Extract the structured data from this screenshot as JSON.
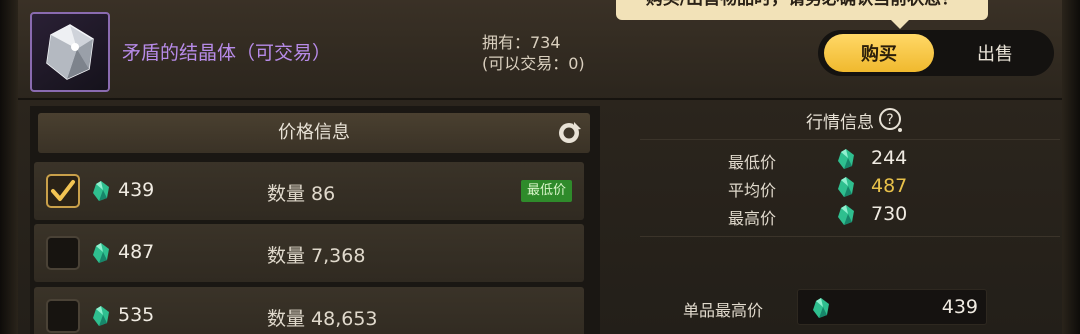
{
  "header": {
    "item_name": "矛盾的结晶体（可交易）",
    "owned": "拥有：734",
    "tradable": "(可以交易：0)"
  },
  "tooltip": {
    "text": "购买/出售物品时，请务必确认当前状态！"
  },
  "toggle": {
    "buy_label": "购买",
    "sell_label": "出售",
    "selected": "购买"
  },
  "price_list": {
    "title": "价格信息",
    "rows": [
      {
        "price": "439",
        "quantity": "数量 86",
        "checked": true,
        "badge": "最低价"
      },
      {
        "price": "487",
        "quantity": "数量 7,368",
        "checked": false,
        "badge": ""
      },
      {
        "price": "535",
        "quantity": "数量 48,653",
        "checked": false,
        "badge": ""
      }
    ]
  },
  "market_info": {
    "title": "行情信息",
    "min_label": "最低价",
    "min_value": "244",
    "avg_label": "平均价",
    "avg_value": "487",
    "max_label": "最高价",
    "max_value": "730"
  },
  "unit_max": {
    "label": "单品最高价",
    "value": "439"
  },
  "icons": {
    "item": "crystal-item-icon",
    "currency": "green-gem-icon",
    "refresh": "refresh-icon",
    "help": "help-icon",
    "check": "checkmark-icon"
  },
  "colors": {
    "accent_yellow": "#f0b92e",
    "item_name_purple": "#b78be8",
    "badge_green": "#2f8b2b",
    "avg_price": "#e8c14a"
  }
}
